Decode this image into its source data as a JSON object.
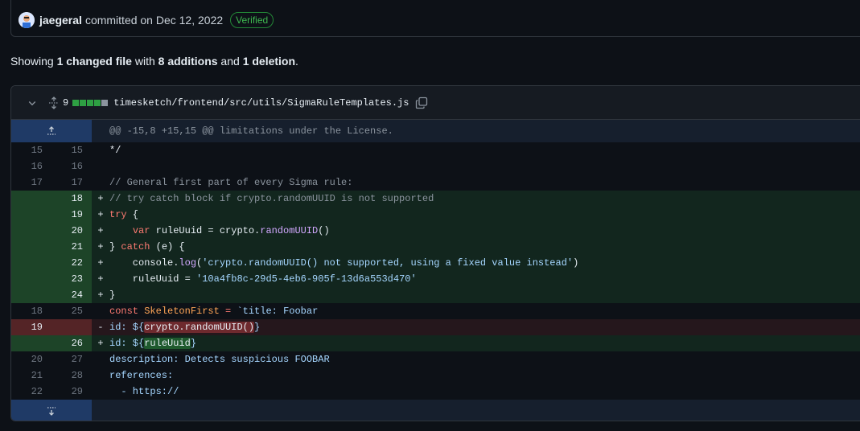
{
  "commit": {
    "author": "jaegeral",
    "text": "committed on Dec 12, 2022",
    "badge": "Verified"
  },
  "summary": {
    "prefix": "Showing ",
    "files": "1 changed file",
    "mid": " with ",
    "additions": "8 additions",
    "and": " and ",
    "deletions": "1 deletion",
    "end": "."
  },
  "file": {
    "change_count": "9",
    "path": "timesketch/frontend/src/utils/SigmaRuleTemplates.js",
    "diffstat_colors": [
      "#2ea043",
      "#2ea043",
      "#2ea043",
      "#2ea043",
      "#8b949e"
    ]
  },
  "hunk": {
    "header": "@@ -15,8 +15,15 @@ limitations under the License."
  },
  "lines": [
    {
      "type": "ctx",
      "old": "15",
      "new": "15",
      "marker": "",
      "tokens": [
        {
          "t": "*/",
          "c": ""
        }
      ]
    },
    {
      "type": "ctx",
      "old": "16",
      "new": "16",
      "marker": "",
      "tokens": []
    },
    {
      "type": "ctx",
      "old": "17",
      "new": "17",
      "marker": "",
      "tokens": [
        {
          "t": "// General first part of every Sigma rule:",
          "c": "cm"
        }
      ]
    },
    {
      "type": "add",
      "old": "",
      "new": "18",
      "marker": "+",
      "tokens": [
        {
          "t": "// try catch block if crypto.randomUUID is not supported",
          "c": "cm"
        }
      ]
    },
    {
      "type": "add",
      "old": "",
      "new": "19",
      "marker": "+",
      "tokens": [
        {
          "t": "try",
          "c": "kw"
        },
        {
          "t": " {",
          "c": ""
        }
      ]
    },
    {
      "type": "add",
      "old": "",
      "new": "20",
      "marker": "+",
      "tokens": [
        {
          "t": "    ",
          "c": ""
        },
        {
          "t": "var",
          "c": "kw"
        },
        {
          "t": " ruleUuid = crypto.",
          "c": ""
        },
        {
          "t": "randomUUID",
          "c": "fn"
        },
        {
          "t": "()",
          "c": ""
        }
      ]
    },
    {
      "type": "add",
      "old": "",
      "new": "21",
      "marker": "+",
      "tokens": [
        {
          "t": "} ",
          "c": ""
        },
        {
          "t": "catch",
          "c": "kw"
        },
        {
          "t": " (e) {",
          "c": ""
        }
      ]
    },
    {
      "type": "add",
      "old": "",
      "new": "22",
      "marker": "+",
      "tokens": [
        {
          "t": "    console.",
          "c": ""
        },
        {
          "t": "log",
          "c": "fn"
        },
        {
          "t": "(",
          "c": ""
        },
        {
          "t": "'crypto.randomUUID() not supported, using a fixed value instead'",
          "c": "str"
        },
        {
          "t": ")",
          "c": ""
        }
      ]
    },
    {
      "type": "add",
      "old": "",
      "new": "23",
      "marker": "+",
      "tokens": [
        {
          "t": "    ruleUuid = ",
          "c": ""
        },
        {
          "t": "'10a4fb8c-29d5-4eb6-905f-13d6a553d470'",
          "c": "str"
        }
      ]
    },
    {
      "type": "add",
      "old": "",
      "new": "24",
      "marker": "+",
      "tokens": [
        {
          "t": "}",
          "c": ""
        }
      ]
    },
    {
      "type": "ctx",
      "old": "18",
      "new": "25",
      "marker": "",
      "tokens": [
        {
          "t": "const",
          "c": "kw"
        },
        {
          "t": " ",
          "c": ""
        },
        {
          "t": "SkeletonFirst",
          "c": "var"
        },
        {
          "t": " = ",
          "c": "kw"
        },
        {
          "t": "`title: Foobar",
          "c": "str"
        }
      ]
    },
    {
      "type": "del",
      "old": "19",
      "new": "",
      "marker": "-",
      "tokens": [
        {
          "t": "id: ${",
          "c": "str"
        },
        {
          "t": "crypto.randomUUID()",
          "c": "hl-del"
        },
        {
          "t": "}",
          "c": "str"
        }
      ]
    },
    {
      "type": "add",
      "old": "",
      "new": "26",
      "marker": "+",
      "tokens": [
        {
          "t": "id: ${",
          "c": "str"
        },
        {
          "t": "ruleUuid",
          "c": "hl-add"
        },
        {
          "t": "}",
          "c": "str"
        }
      ]
    },
    {
      "type": "ctx",
      "old": "20",
      "new": "27",
      "marker": "",
      "tokens": [
        {
          "t": "description: Detects suspicious FOOBAR",
          "c": "str"
        }
      ]
    },
    {
      "type": "ctx",
      "old": "21",
      "new": "28",
      "marker": "",
      "tokens": [
        {
          "t": "references:",
          "c": "str"
        }
      ]
    },
    {
      "type": "ctx",
      "old": "22",
      "new": "29",
      "marker": "",
      "tokens": [
        {
          "t": "  - https://",
          "c": "str"
        }
      ]
    }
  ]
}
